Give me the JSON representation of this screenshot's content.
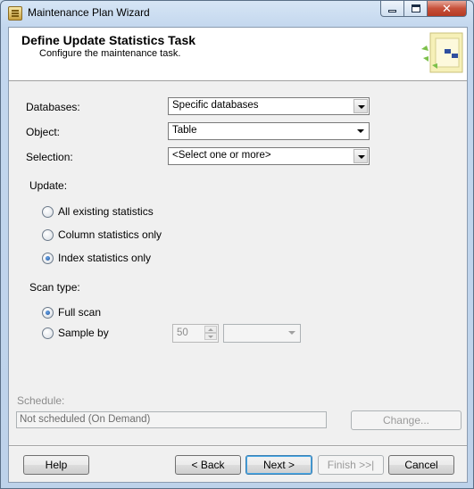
{
  "window": {
    "title": "Maintenance Plan Wizard",
    "close_glyph": "✕"
  },
  "header": {
    "title": "Define Update Statistics Task",
    "subtitle": "Configure the maintenance task."
  },
  "form": {
    "databases_label": "Databases:",
    "databases_value": "Specific databases",
    "object_label": "Object:",
    "object_value": "Table",
    "selection_label": "Selection:",
    "selection_value": "<Select one or more>",
    "update_label": "Update:",
    "update_options": [
      {
        "label": "All existing statistics",
        "checked": false
      },
      {
        "label": "Column statistics only",
        "checked": false
      },
      {
        "label": "Index statistics only",
        "checked": true
      }
    ],
    "scan_type_label": "Scan type:",
    "scan_options": [
      {
        "label": "Full scan",
        "checked": true
      },
      {
        "label": "Sample by",
        "checked": false
      }
    ],
    "sample_value": "50",
    "sample_unit": ""
  },
  "schedule": {
    "label": "Schedule:",
    "value": "Not scheduled (On Demand)",
    "change_button": "Change..."
  },
  "footer": {
    "help": "Help",
    "back": "< Back",
    "next": "Next >",
    "finish": "Finish >>|",
    "cancel": "Cancel"
  },
  "colors": {
    "accent": "#3c7fb1",
    "close_button": "#c7503a"
  }
}
